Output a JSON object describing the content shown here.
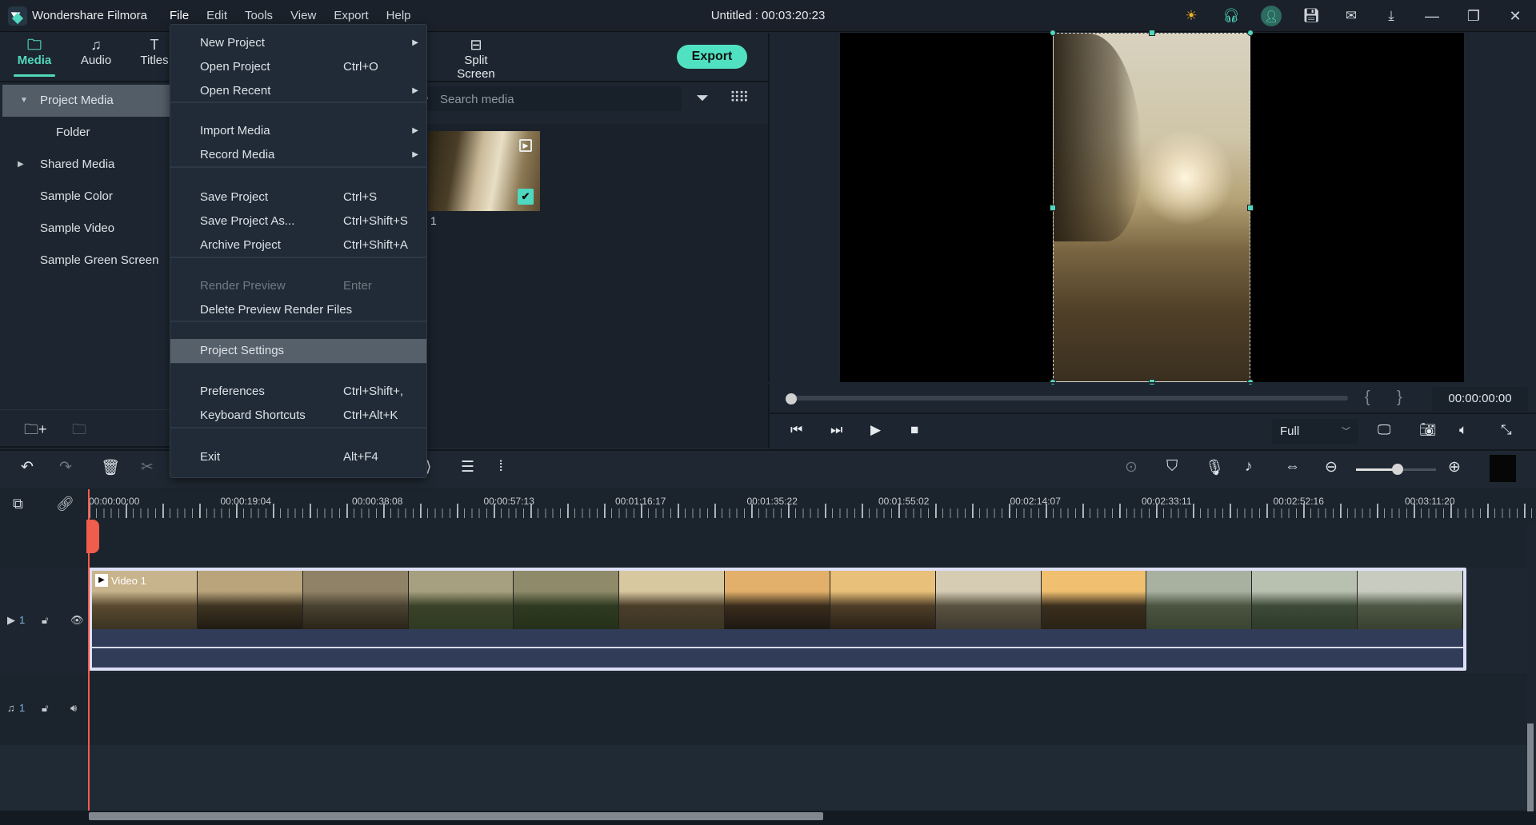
{
  "app": {
    "name": "Wondershare Filmora",
    "document_title": "Untitled : 00:03:20:23",
    "menubar": [
      "File",
      "Edit",
      "Tools",
      "View",
      "Export",
      "Help"
    ],
    "titlebar_icons": [
      "lightbulb-icon",
      "headset-icon",
      "user-icon",
      "save-icon",
      "mail-icon",
      "download-icon"
    ],
    "window_controls": {
      "minimize": "—",
      "restore": "❐",
      "close": "✕"
    }
  },
  "tabs": [
    {
      "label": "Media",
      "icon": "folder-icon",
      "active": true
    },
    {
      "label": "Audio",
      "icon": "music-note-icon",
      "active": false
    },
    {
      "label": "Titles",
      "icon": "text-icon",
      "active": false
    },
    {
      "label": "Split Screen",
      "icon": "split-screen-icon",
      "active": false
    }
  ],
  "export_label": "Export",
  "sidebar": {
    "items": [
      {
        "label": "Project Media",
        "expanded": true,
        "selected": true
      },
      {
        "label": "Folder",
        "sub": true
      },
      {
        "label": "Shared Media",
        "collapsed": true
      },
      {
        "label": "Sample Color"
      },
      {
        "label": "Sample Video"
      },
      {
        "label": "Sample Green Screen"
      }
    ],
    "footer_icons": [
      "new-folder-icon",
      "delete-folder-icon"
    ]
  },
  "media": {
    "search_placeholder": "Search media",
    "items": [
      {
        "label": "1",
        "checked": true
      }
    ]
  },
  "file_menu": {
    "items": [
      {
        "label": "New Project",
        "shortcut": "",
        "submenu": true
      },
      {
        "label": "Open Project",
        "shortcut": "Ctrl+O"
      },
      {
        "label": "Open Recent",
        "shortcut": "",
        "submenu": true
      },
      {
        "label": "Import Media",
        "shortcut": "",
        "submenu": true
      },
      {
        "label": "Record Media",
        "shortcut": "",
        "submenu": true
      },
      {
        "label": "Save Project",
        "shortcut": "Ctrl+S"
      },
      {
        "label": "Save Project As...",
        "shortcut": "Ctrl+Shift+S"
      },
      {
        "label": "Archive Project",
        "shortcut": "Ctrl+Shift+A"
      },
      {
        "label": "Render Preview",
        "shortcut": "Enter",
        "disabled": true
      },
      {
        "label": "Delete Preview Render Files",
        "shortcut": ""
      },
      {
        "label": "Project Settings",
        "shortcut": "",
        "highlighted": true
      },
      {
        "label": "Preferences",
        "shortcut": "Ctrl+Shift+,"
      },
      {
        "label": "Keyboard Shortcuts",
        "shortcut": "Ctrl+Alt+K"
      },
      {
        "label": "Exit",
        "shortcut": "Alt+F4"
      }
    ]
  },
  "preview": {
    "timecode": "00:00:00:00",
    "progress": 0,
    "quality": "Full",
    "mark_in": "{",
    "mark_out": "}"
  },
  "timeline": {
    "ruler_labels": [
      "00:00:00:00",
      "00:00:19:04",
      "00:00:38:08",
      "00:00:57:13",
      "00:01:16:17",
      "00:01:35:22",
      "00:01:55:02",
      "00:02:14:07",
      "00:02:33:11",
      "00:02:52:16",
      "00:03:11:20"
    ],
    "zoom_level": 0.52,
    "tracks": [
      {
        "type": "video",
        "number": "1"
      },
      {
        "type": "audio",
        "number": "1"
      }
    ],
    "clip_label": "Video 1"
  }
}
